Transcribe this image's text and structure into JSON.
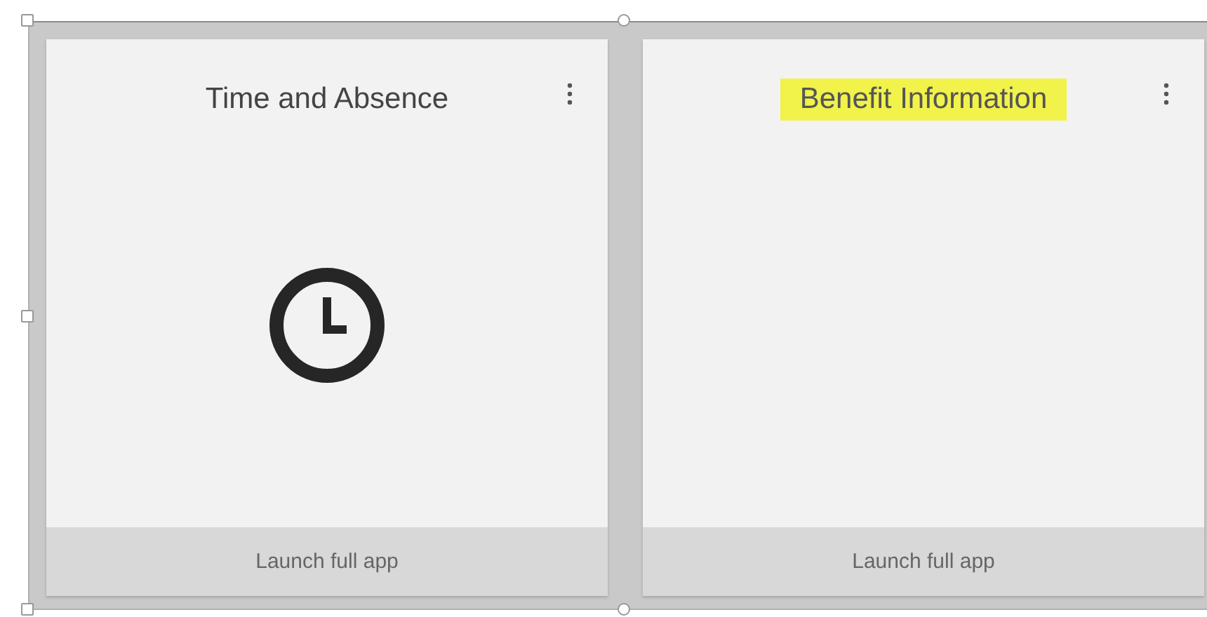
{
  "cards": [
    {
      "title": "Time and Absence",
      "highlighted": false,
      "kind": "clock",
      "footer": "Launch full app"
    },
    {
      "title": "Benefit Information",
      "highlighted": true,
      "kind": "blank",
      "footer": "Launch full app"
    }
  ]
}
